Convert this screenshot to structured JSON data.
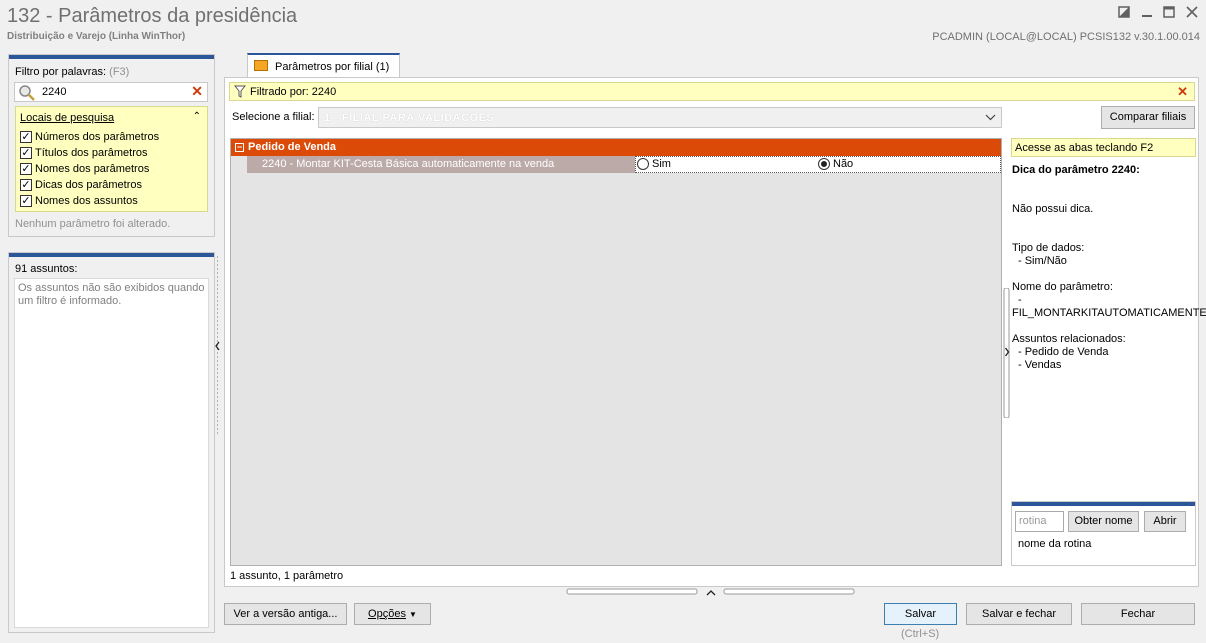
{
  "window": {
    "title": "132 - Parâmetros da presidência",
    "subtitle": "Distribuição e Varejo (Linha WinThor)",
    "user_info": "PCADMIN (LOCAL@LOCAL)   PCSIS132  v.30.1.00.014",
    "buttons": [
      "restore-icon",
      "minimize-icon",
      "maximize-icon",
      "close-icon"
    ]
  },
  "filter": {
    "label": "Filtro por palavras:",
    "hint": "(F3)",
    "search_value": "2240",
    "locais_title": "Locais de pesquisa",
    "options": [
      {
        "label": "Números dos parâmetros",
        "checked": true
      },
      {
        "label": "Títulos dos parâmetros",
        "checked": true
      },
      {
        "label": "Nomes dos parâmetros",
        "checked": true
      },
      {
        "label": "Dicas dos parâmetros",
        "checked": true
      },
      {
        "label": "Nomes dos assuntos",
        "checked": true
      }
    ],
    "status": "Nenhum parâmetro foi alterado."
  },
  "assuntos": {
    "count_label": "91 assuntos:",
    "message": "Os assuntos não são exibidos quando um filtro é informado."
  },
  "tab": {
    "label": "Parâmetros por filial  (1)"
  },
  "filter_bar": {
    "text": "Filtrado por: 2240"
  },
  "filial": {
    "label": "Selecione a filial:",
    "value": "1 - FILIAL PARA VALIDACOES",
    "compare_button": "Comparar filiais"
  },
  "grid": {
    "group_label": "Pedido de Venda",
    "group_toggle": "−",
    "param_label": "2240 - Montar KIT-Cesta Básica automaticamente na venda",
    "option_sim": "Sim",
    "option_nao": "Não",
    "selected": "Não"
  },
  "status_line": "1 assunto, 1 parâmetro",
  "dica": {
    "hint": "Acesse as abas teclando F2",
    "title": "Dica do parâmetro 2240:",
    "body": "Não possui dica.",
    "tipo_label": "Tipo de dados:",
    "tipo_value": "- Sim/Não",
    "nome_label": "Nome do parâmetro:",
    "nome_dash": "-",
    "nome_value": "FIL_MONTARKITAUTOMATICAMENTE",
    "assuntos_label": "Assuntos relacionados:",
    "assuntos": [
      "- Pedido de Venda",
      "- Vendas"
    ]
  },
  "rotina": {
    "placeholder": "rotina",
    "obter_button": "Obter nome",
    "abrir_button": "Abrir",
    "nome_label": "nome da rotina"
  },
  "footer": {
    "ver_button": "Ver a versão antiga...",
    "opcoes_button": "Opções",
    "salvar_button": "Salvar",
    "salvar_shortcut": "(Ctrl+S)",
    "salvar_fechar_button": "Salvar e fechar",
    "fechar_button": "Fechar"
  }
}
